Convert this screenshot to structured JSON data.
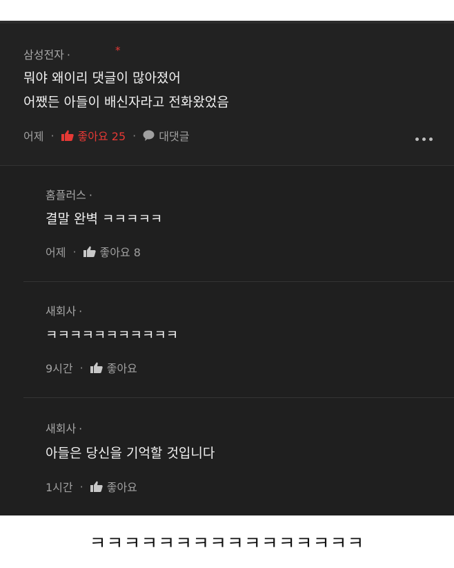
{
  "main_comment": {
    "author": "삼성전자",
    "text_line1": "뭐야 왜이리 댓글이 많아졌어",
    "text_line2": "어쨌든 아들이 배신자라고 전화왔었음",
    "time": "어제",
    "like_label": "좋아요 25",
    "reply_label": "대댓글"
  },
  "replies": [
    {
      "author": "홈플러스",
      "text": "결말 완벽 ㅋㅋㅋㅋㅋ",
      "time": "어제",
      "like_label": "좋아요 8"
    },
    {
      "author": "새회사",
      "text": "ㅋㅋㅋㅋㅋㅋㅋㅋㅋㅋㅋ",
      "time": "9시간",
      "like_label": "좋아요"
    },
    {
      "author": "새회사",
      "text": "아들은 당신을 기억할 것입니다",
      "time": "1시간",
      "like_label": "좋아요"
    }
  ],
  "caption": "ㅋㅋㅋㅋㅋㅋㅋㅋㅋㅋㅋㅋㅋㅋㅋㅋ",
  "colors": {
    "like_active": "#e53935",
    "background": "#1e1e1e",
    "text": "#f0f0f0",
    "muted": "#a0a0a0"
  },
  "icons": {
    "like": "thumbs-up-icon",
    "reply": "speech-bubble-icon",
    "more": "more-dots-icon"
  }
}
